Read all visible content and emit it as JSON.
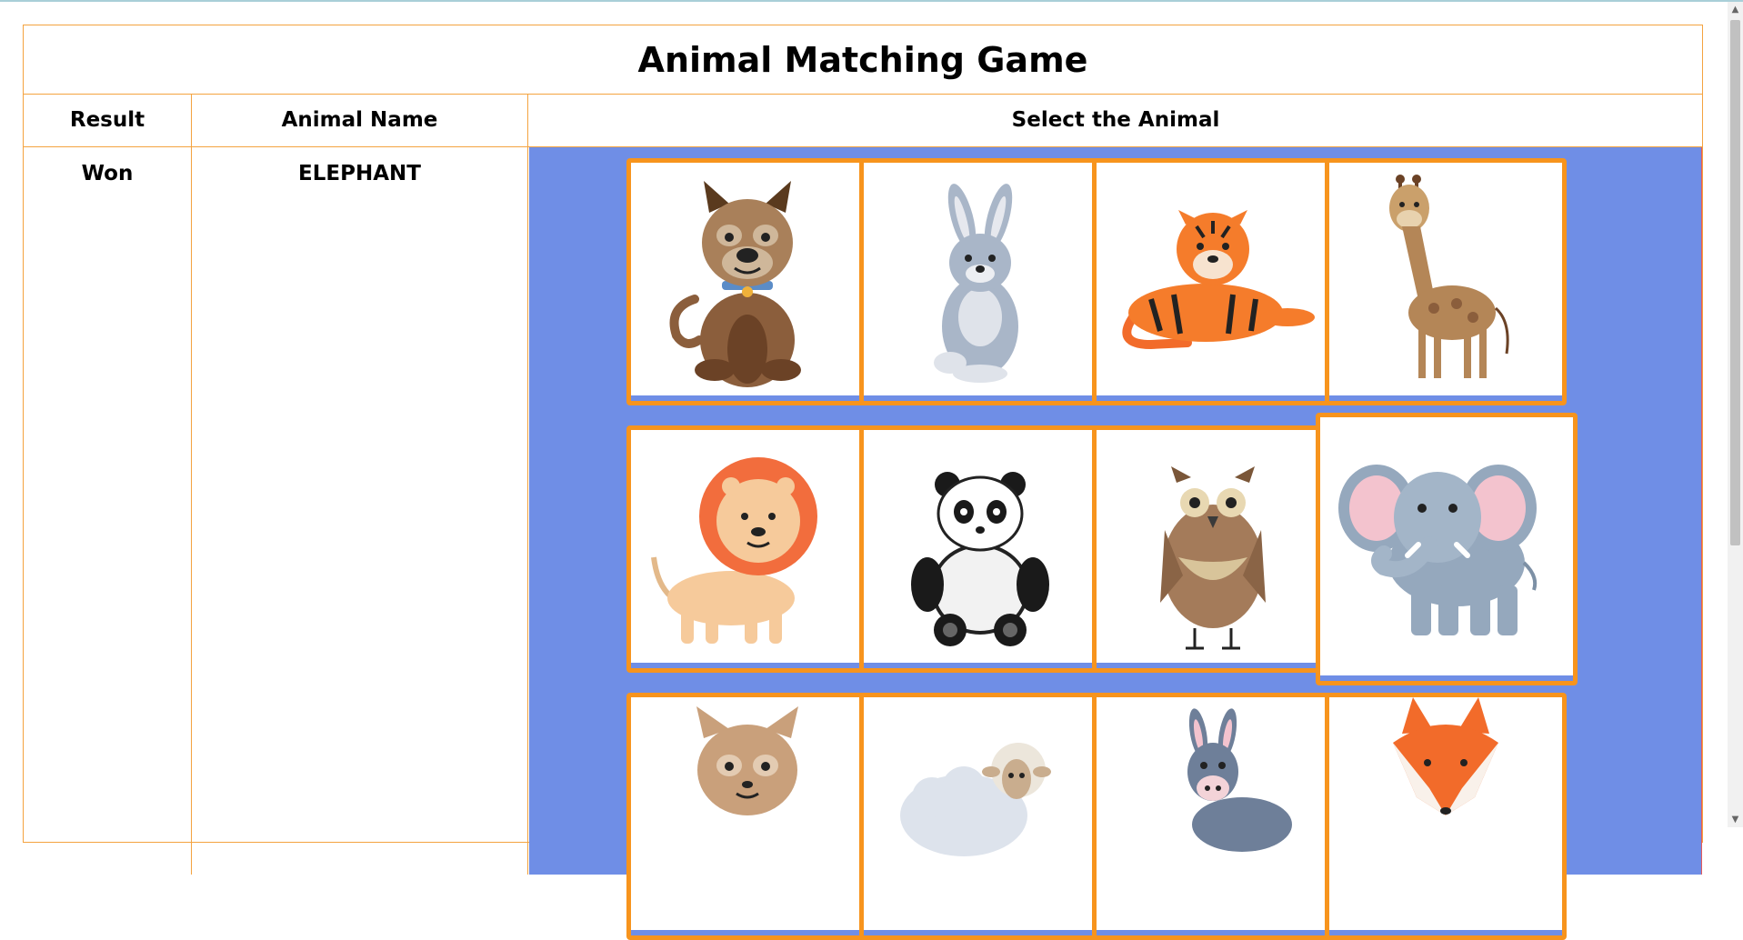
{
  "game": {
    "title": "Animal Matching Game"
  },
  "table": {
    "headers": {
      "result": "Result",
      "animal_name": "Animal Name",
      "select": "Select the Animal"
    },
    "result_value": "Won",
    "animal_name_value": "ELEPHANT"
  },
  "cards": [
    {
      "animal": "dog"
    },
    {
      "animal": "rabbit"
    },
    {
      "animal": "tiger"
    },
    {
      "animal": "giraffe"
    },
    {
      "animal": "lion"
    },
    {
      "animal": "panda"
    },
    {
      "animal": "owl"
    },
    {
      "animal": "elephant",
      "selected": true
    },
    {
      "animal": "cat"
    },
    {
      "animal": "sheep"
    },
    {
      "animal": "donkey"
    },
    {
      "animal": "fox"
    }
  ],
  "colors": {
    "border": "#f4a340",
    "card_border": "#f7941d",
    "board_bg": "#6f8ee6"
  }
}
